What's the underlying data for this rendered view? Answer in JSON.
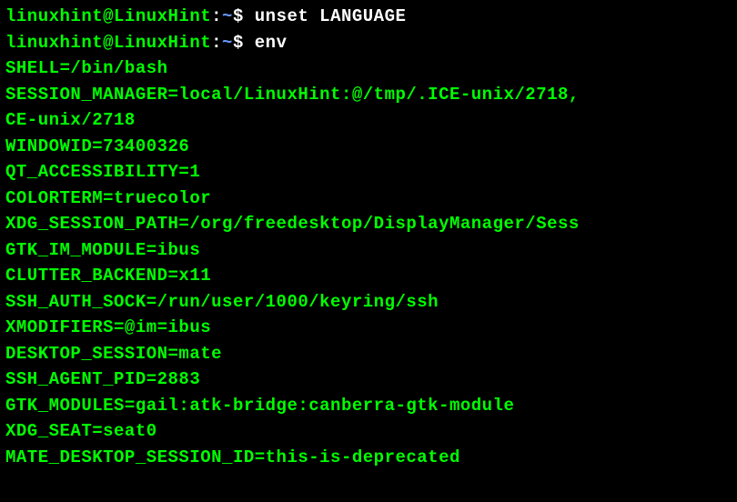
{
  "prompt": {
    "user_host": "linuxhint@LinuxHint",
    "colon": ":",
    "path": "~",
    "dollar": "$"
  },
  "commands": {
    "cmd1": " unset LANGUAGE",
    "cmd2": " env"
  },
  "env": {
    "line1": "SHELL=/bin/bash",
    "line2": "SESSION_MANAGER=local/LinuxHint:@/tmp/.ICE-unix/2718,",
    "line3": "CE-unix/2718",
    "line4": "WINDOWID=73400326",
    "line5": "QT_ACCESSIBILITY=1",
    "line6": "COLORTERM=truecolor",
    "line7": "XDG_SESSION_PATH=/org/freedesktop/DisplayManager/Sess",
    "line8": "GTK_IM_MODULE=ibus",
    "line9": "CLUTTER_BACKEND=x11",
    "line10": "SSH_AUTH_SOCK=/run/user/1000/keyring/ssh",
    "line11": "XMODIFIERS=@im=ibus",
    "line12": "DESKTOP_SESSION=mate",
    "line13": "SSH_AGENT_PID=2883",
    "line14": "GTK_MODULES=gail:atk-bridge:canberra-gtk-module",
    "line15": "XDG_SEAT=seat0",
    "line16": "MATE_DESKTOP_SESSION_ID=this-is-deprecated"
  }
}
